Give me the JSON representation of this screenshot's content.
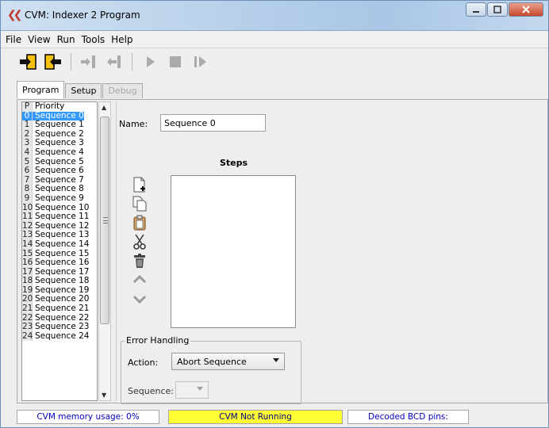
{
  "window": {
    "title": "CVM: Indexer 2 Program",
    "app_icon": "cvm-logo-icon",
    "accent": "#c0392b"
  },
  "menu": {
    "items": [
      "File",
      "View",
      "Run",
      "Tools",
      "Help"
    ]
  },
  "toolbar": {
    "icons": [
      "import-icon",
      "export-icon",
      "step-in-icon",
      "step-out-icon",
      "play-icon",
      "stop-icon",
      "step-play-icon"
    ]
  },
  "tabs": [
    {
      "label": "Program",
      "state": "active"
    },
    {
      "label": "Setup",
      "state": "normal"
    },
    {
      "label": "Debug",
      "state": "disabled"
    }
  ],
  "sequence_list": {
    "rows": [
      {
        "idx": "P",
        "name": "Priority"
      },
      {
        "idx": "0",
        "name": "Sequence 0",
        "selected": true
      },
      {
        "idx": "1",
        "name": "Sequence 1"
      },
      {
        "idx": "2",
        "name": "Sequence 2"
      },
      {
        "idx": "3",
        "name": "Sequence 3"
      },
      {
        "idx": "4",
        "name": "Sequence 4"
      },
      {
        "idx": "5",
        "name": "Sequence 5"
      },
      {
        "idx": "6",
        "name": "Sequence 6"
      },
      {
        "idx": "7",
        "name": "Sequence 7"
      },
      {
        "idx": "8",
        "name": "Sequence 8"
      },
      {
        "idx": "9",
        "name": "Sequence 9"
      },
      {
        "idx": "10",
        "name": "Sequence 10"
      },
      {
        "idx": "11",
        "name": "Sequence 11"
      },
      {
        "idx": "12",
        "name": "Sequence 12"
      },
      {
        "idx": "13",
        "name": "Sequence 13"
      },
      {
        "idx": "14",
        "name": "Sequence 14"
      },
      {
        "idx": "15",
        "name": "Sequence 15"
      },
      {
        "idx": "16",
        "name": "Sequence 16"
      },
      {
        "idx": "17",
        "name": "Sequence 17"
      },
      {
        "idx": "18",
        "name": "Sequence 18"
      },
      {
        "idx": "19",
        "name": "Sequence 19"
      },
      {
        "idx": "20",
        "name": "Sequence 20"
      },
      {
        "idx": "21",
        "name": "Sequence 21"
      },
      {
        "idx": "22",
        "name": "Sequence 22"
      },
      {
        "idx": "23",
        "name": "Sequence 23"
      },
      {
        "idx": "24",
        "name": "Sequence 24"
      }
    ]
  },
  "editor": {
    "name_label": "Name:",
    "name_value": "Sequence 0",
    "steps_title": "Steps",
    "step_icons": [
      "new-step-icon",
      "copy-icon",
      "paste-icon",
      "cut-icon",
      "delete-icon",
      "move-up-icon",
      "move-down-icon"
    ]
  },
  "error_handling": {
    "legend": "Error Handling",
    "action_label": "Action:",
    "action_value": "Abort Sequence",
    "sequence_label": "Sequence:",
    "sequence_value": ""
  },
  "status": {
    "memory": "CVM memory usage: 0%",
    "running": "CVM Not Running",
    "bcd": "Decoded BCD pins:",
    "running_color": "#ffff33"
  }
}
